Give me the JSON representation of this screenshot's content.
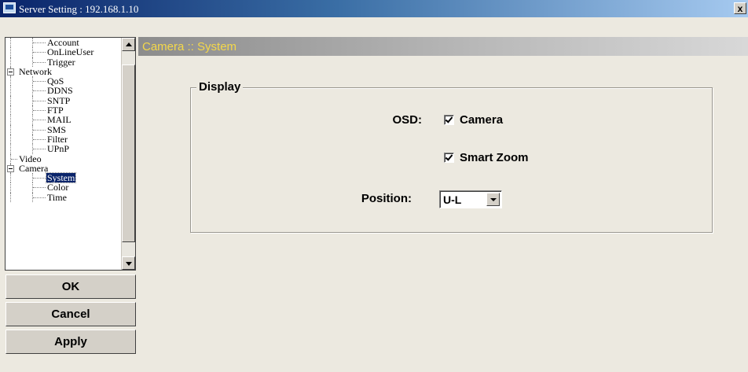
{
  "window": {
    "title": "Server Setting : 192.168.1.10",
    "close_label": "x"
  },
  "tree": {
    "items": [
      {
        "label": "Account",
        "level": 2,
        "expander": false,
        "selected": false
      },
      {
        "label": "OnLineUser",
        "level": 2,
        "expander": false,
        "selected": false
      },
      {
        "label": "Trigger",
        "level": 2,
        "expander": false,
        "selected": false
      },
      {
        "label": "Network",
        "level": 1,
        "expander": true,
        "selected": false
      },
      {
        "label": "QoS",
        "level": 2,
        "expander": false,
        "selected": false
      },
      {
        "label": "DDNS",
        "level": 2,
        "expander": false,
        "selected": false
      },
      {
        "label": "SNTP",
        "level": 2,
        "expander": false,
        "selected": false
      },
      {
        "label": "FTP",
        "level": 2,
        "expander": false,
        "selected": false
      },
      {
        "label": "MAIL",
        "level": 2,
        "expander": false,
        "selected": false
      },
      {
        "label": "SMS",
        "level": 2,
        "expander": false,
        "selected": false
      },
      {
        "label": "Filter",
        "level": 2,
        "expander": false,
        "selected": false
      },
      {
        "label": "UPnP",
        "level": 2,
        "expander": false,
        "selected": false
      },
      {
        "label": "Video",
        "level": 1,
        "expander": false,
        "selected": false
      },
      {
        "label": "Camera",
        "level": 1,
        "expander": true,
        "selected": false
      },
      {
        "label": "System",
        "level": 2,
        "expander": false,
        "selected": true
      },
      {
        "label": "Color",
        "level": 2,
        "expander": false,
        "selected": false
      },
      {
        "label": "Time",
        "level": 2,
        "expander": false,
        "selected": false
      }
    ]
  },
  "buttons": {
    "ok": "OK",
    "cancel": "Cancel",
    "apply": "Apply"
  },
  "panel": {
    "header": "Camera :: System"
  },
  "display_group": {
    "legend": "Display",
    "osd_label": "OSD:",
    "camera_checkbox": {
      "label": "Camera",
      "checked": true
    },
    "smart_zoom_checkbox": {
      "label": "Smart Zoom",
      "checked": true
    },
    "position_label": "Position:",
    "position_select": {
      "value": "U-L"
    }
  },
  "colors": {
    "header_text": "#f4d84a",
    "title_bar": "#0a246a",
    "selection": "#0a246a"
  }
}
